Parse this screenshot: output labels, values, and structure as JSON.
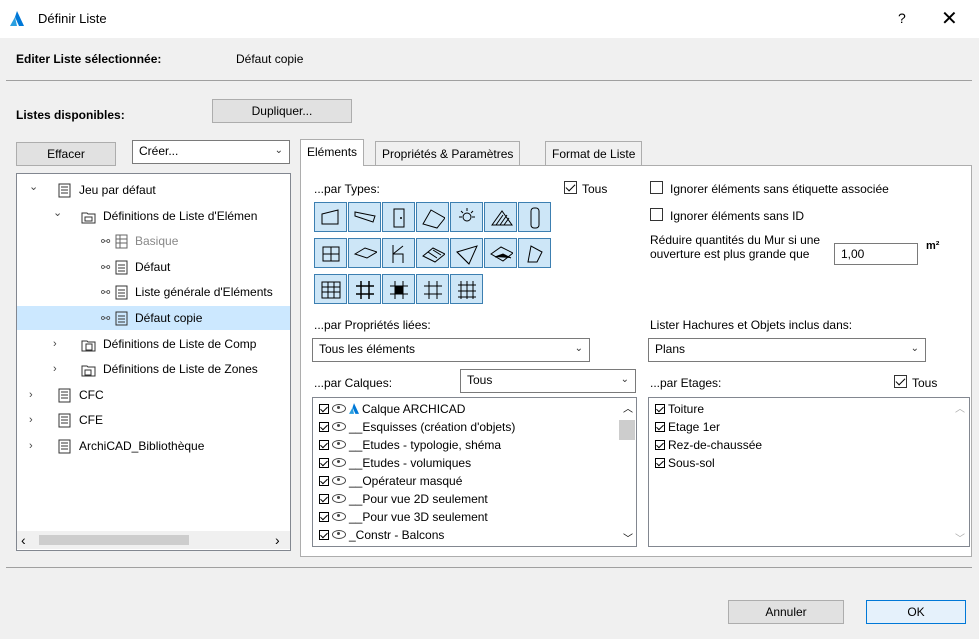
{
  "window": {
    "title": "Définir Liste",
    "help": "?",
    "close": "✕"
  },
  "header": {
    "edit_label": "Editer Liste sélectionnée:",
    "edit_value": "Défaut copie"
  },
  "left": {
    "available_label": "Listes disponibles:",
    "duplicate_btn": "Dupliquer...",
    "clear_btn": "Effacer",
    "create_combo": "Créer..."
  },
  "tree": [
    {
      "label": "Jeu par défaut",
      "twisty": "⌄",
      "icon": "doc"
    },
    {
      "label": "Définitions de Liste d'Elémen",
      "twisty": "⌄",
      "icon": "folder"
    },
    {
      "label": "Basique",
      "twisty": "",
      "icon": "lock-grid"
    },
    {
      "label": "Défaut",
      "twisty": "",
      "icon": "lock-list"
    },
    {
      "label": "Liste générale d'Eléments",
      "twisty": "",
      "icon": "lock-list"
    },
    {
      "label": "Défaut copie",
      "twisty": "",
      "icon": "unlock-list"
    },
    {
      "label": "Définitions de Liste de Comp",
      "twisty": "›",
      "icon": "folder-comp"
    },
    {
      "label": "Définitions de Liste de Zones",
      "twisty": "›",
      "icon": "folder-zone"
    },
    {
      "label": "CFC",
      "twisty": "›",
      "icon": "doc"
    },
    {
      "label": "CFE",
      "twisty": "›",
      "icon": "doc"
    },
    {
      "label": "ArchiCAD_Bibliothèque",
      "twisty": "›",
      "icon": "doc"
    }
  ],
  "tabs": [
    "Eléments",
    "Propriétés & Paramètres",
    "Format de Liste"
  ],
  "elements": {
    "by_types": "...par Types:",
    "all_types": "Tous",
    "ignore_no_label": "Ignorer éléments sans étiquette associée",
    "ignore_no_id": "Ignorer éléments sans ID",
    "reduce_text": "Réduire quantités du Mur si une ouverture est plus grande que",
    "reduce_value": "1,00",
    "unit": "m²",
    "by_properties": "...par Propriétés liées:",
    "properties_value": "Tous les éléments",
    "hatch_label": "Lister Hachures et Objets inclus dans:",
    "hatch_value": "Plans",
    "by_layers": "...par Calques:",
    "layers_combo": "Tous",
    "layers": [
      "Calque ARCHICAD",
      "__Esquisses (création d'objets)",
      "__Etudes - typologie, shéma",
      "__Etudes - volumiques",
      "__Opérateur masqué",
      "__Pour vue 2D seulement",
      "__Pour vue 3D seulement",
      "_Constr - Balcons"
    ],
    "by_stories": "...par Etages:",
    "all_stories": "Tous",
    "stories": [
      "Toiture",
      "Etage 1er",
      "Rez-de-chaussée",
      "Sous-sol"
    ]
  },
  "footer": {
    "cancel": "Annuler",
    "ok": "OK"
  },
  "colors": {
    "accent": "#0078d7",
    "selection": "#cce8ff",
    "toolbtn": "#cde6f7"
  }
}
